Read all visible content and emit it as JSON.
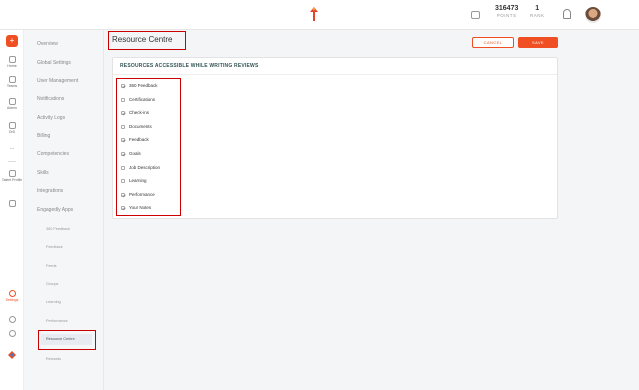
{
  "header": {
    "points_value": "316473",
    "points_label": "POINTS",
    "rank_value": "1",
    "rank_label": "RANK",
    "accent_color": "#f04e23"
  },
  "rail": {
    "items": [
      {
        "label": "Home",
        "icon": "home-icon"
      },
      {
        "label": "Teams",
        "icon": "teams-icon"
      },
      {
        "label": "Admin",
        "icon": "admin-icon"
      },
      {
        "label": "OrD",
        "icon": "org-icon"
      },
      {
        "label": "...",
        "icon": "more-icon"
      },
      {
        "label": "Talent Profile",
        "icon": "profile-icon"
      },
      {
        "label": "",
        "icon": "grid-icon"
      },
      {
        "label": "Settings",
        "icon": "settings-icon"
      }
    ]
  },
  "sidebar": {
    "items": [
      "Overview",
      "Global Settings",
      "User Management",
      "Notifications",
      "Activity Logs",
      "Billing",
      "Competencies",
      "Skills",
      "Integrations",
      "Engagedly Apps"
    ],
    "subitems": [
      "360 Feedback",
      "Feedback",
      "Feeds",
      "Groups",
      "Learning",
      "Performance",
      "Resource Centre",
      "Rewards"
    ]
  },
  "main": {
    "page_title": "Resource Centre",
    "cancel_label": "CANCEL",
    "save_label": "SAVE",
    "card_title": "RESOURCES ACCESSIBLE WHILE WRITING REVIEWS",
    "resources": [
      {
        "label": "360 Feedback",
        "checked": true
      },
      {
        "label": "Certifications",
        "checked": false
      },
      {
        "label": "Check-ins",
        "checked": true
      },
      {
        "label": "Documents",
        "checked": false
      },
      {
        "label": "Feedback",
        "checked": true
      },
      {
        "label": "Goals",
        "checked": true
      },
      {
        "label": "Job Description",
        "checked": false
      },
      {
        "label": "Learning",
        "checked": false
      },
      {
        "label": "Performance",
        "checked": true
      },
      {
        "label": "Your Notes",
        "checked": true
      }
    ]
  }
}
